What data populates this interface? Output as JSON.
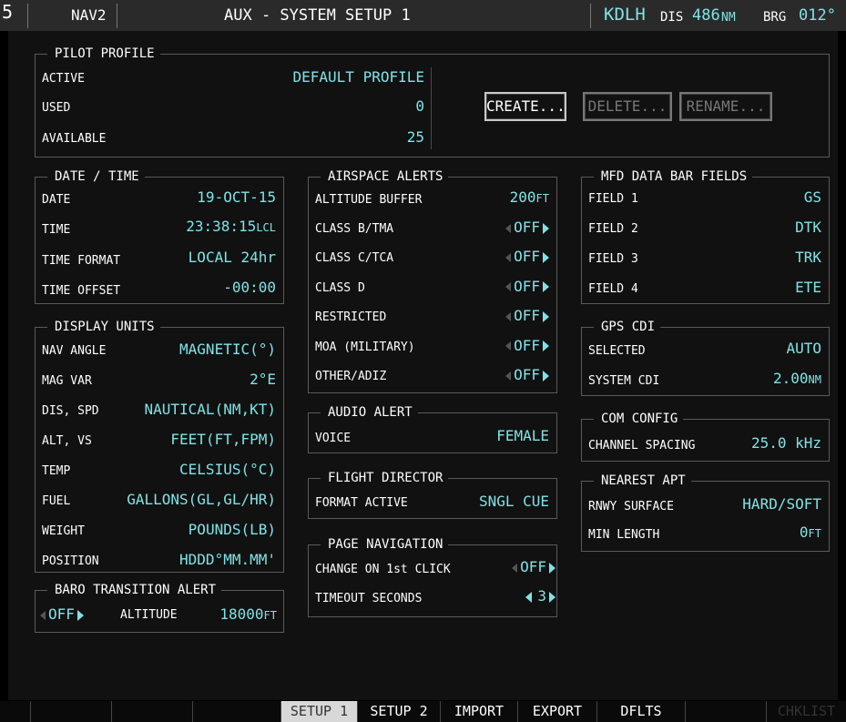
{
  "topbar": {
    "page_number": "5",
    "nav_source": "NAV2",
    "page_title": "AUX - SYSTEM SETUP 1",
    "waypoint": "KDLH",
    "dis_label": "DIS",
    "dis_value": "486",
    "dis_unit": "NM",
    "brg_label": "BRG",
    "brg_value": "012°"
  },
  "pilot_profile": {
    "title": "PILOT PROFILE",
    "active_label": "ACTIVE",
    "active_value": "DEFAULT PROFILE",
    "used_label": "USED",
    "used_value": "0",
    "available_label": "AVAILABLE",
    "available_value": "25",
    "create_button": "CREATE...",
    "delete_button": "DELETE...",
    "rename_button": "RENAME..."
  },
  "date_time": {
    "title": "DATE / TIME",
    "date_label": "DATE",
    "date_value": "19-OCT-15",
    "time_label": "TIME",
    "time_value": "23:38:15",
    "time_suffix": "LCL",
    "time_format_label": "TIME FORMAT",
    "time_format_value": "LOCAL 24hr",
    "time_offset_label": "TIME OFFSET",
    "time_offset_value": "-00:00"
  },
  "display_units": {
    "title": "DISPLAY UNITS",
    "rows": [
      {
        "label": "NAV ANGLE",
        "value": "MAGNETIC(°)"
      },
      {
        "label": "MAG VAR",
        "value": "2°E"
      },
      {
        "label": "DIS, SPD",
        "value": "NAUTICAL(NM,KT)"
      },
      {
        "label": "ALT, VS",
        "value": "FEET(FT,FPM)"
      },
      {
        "label": "TEMP",
        "value": "CELSIUS(°C)"
      },
      {
        "label": "FUEL",
        "value": "GALLONS(GL,GL/HR)"
      },
      {
        "label": "WEIGHT",
        "value": "POUNDS(LB)"
      },
      {
        "label": "POSITION",
        "value": "HDDD°MM.MM'"
      }
    ]
  },
  "baro_transition": {
    "title": "BARO TRANSITION ALERT",
    "state": "OFF",
    "altitude_label": "ALTITUDE",
    "altitude_value": "18000",
    "altitude_unit": "FT"
  },
  "airspace_alerts": {
    "title": "AIRSPACE ALERTS",
    "altitude_buffer_label": "ALTITUDE BUFFER",
    "altitude_buffer_value": "200",
    "altitude_buffer_unit": "FT",
    "rows": [
      {
        "label": "CLASS B/TMA",
        "value": "OFF"
      },
      {
        "label": "CLASS C/TCA",
        "value": "OFF"
      },
      {
        "label": "CLASS D",
        "value": "OFF"
      },
      {
        "label": "RESTRICTED",
        "value": "OFF"
      },
      {
        "label": "MOA (MILITARY)",
        "value": "OFF"
      },
      {
        "label": "OTHER/ADIZ",
        "value": "OFF"
      }
    ]
  },
  "audio_alert": {
    "title": "AUDIO ALERT",
    "voice_label": "VOICE",
    "voice_value": "FEMALE"
  },
  "flight_director": {
    "title": "FLIGHT DIRECTOR",
    "format_label": "FORMAT ACTIVE",
    "format_value": "SNGL CUE"
  },
  "page_navigation": {
    "title": "PAGE NAVIGATION",
    "change_label": "CHANGE ON 1st CLICK",
    "change_value": "OFF",
    "timeout_label": "TIMEOUT SECONDS",
    "timeout_value": "3"
  },
  "mfd_data_bar": {
    "title": "MFD DATA BAR FIELDS",
    "rows": [
      {
        "label": "FIELD 1",
        "value": "GS"
      },
      {
        "label": "FIELD 2",
        "value": "DTK"
      },
      {
        "label": "FIELD 3",
        "value": "TRK"
      },
      {
        "label": "FIELD 4",
        "value": "ETE"
      }
    ]
  },
  "gps_cdi": {
    "title": "GPS CDI",
    "selected_label": "SELECTED",
    "selected_value": "AUTO",
    "system_label": "SYSTEM CDI",
    "system_value": "2.00",
    "system_unit": "NM"
  },
  "com_config": {
    "title": "COM CONFIG",
    "spacing_label": "CHANNEL SPACING",
    "spacing_value": "25.0 kHz"
  },
  "nearest_apt": {
    "title": "NEAREST APT",
    "surface_label": "RNWY SURFACE",
    "surface_value": "HARD/SOFT",
    "length_label": "MIN LENGTH",
    "length_value": "0",
    "length_unit": "FT"
  },
  "softkeys": [
    "SETUP 1",
    "SETUP 2",
    "IMPORT",
    "EXPORT",
    "DFLTS",
    "CHKLIST"
  ],
  "colors": {
    "cyan": "#7fe3e6",
    "white": "#ffffff",
    "background": "#000000"
  }
}
